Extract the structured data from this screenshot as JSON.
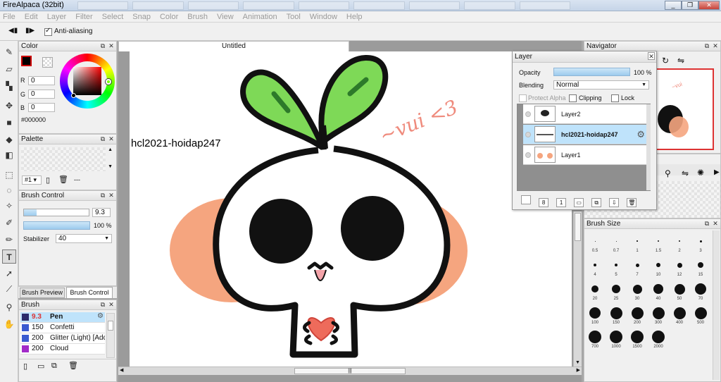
{
  "window": {
    "title": "FireAlpaca (32bit)",
    "min": "_",
    "max": "❐",
    "close": "✕"
  },
  "menu": [
    "File",
    "Edit",
    "Layer",
    "Filter",
    "Select",
    "Snap",
    "Color",
    "Brush",
    "View",
    "Animation",
    "Tool",
    "Window",
    "Help"
  ],
  "options": {
    "anti_alias_label": "Anti-aliasing",
    "anti_alias_checked": true
  },
  "color_panel": {
    "title": "Color",
    "r_label": "R",
    "r": "0",
    "g_label": "G",
    "g": "0",
    "b_label": "B",
    "b": "0",
    "hex": "#000000",
    "fg": "#000000"
  },
  "palette_panel": {
    "title": "Palette",
    "set": "#1",
    "ellipsis": "---"
  },
  "brush_control": {
    "title": "Brush Control",
    "size": "9.3",
    "opacity": "100 %",
    "stabilizer_label": "Stabilizer",
    "stabilizer": "40"
  },
  "bottom_tabs": [
    "Brush Preview",
    "Brush Control"
  ],
  "brush_panel": {
    "title": "Brush",
    "items": [
      {
        "size": "9.3",
        "name": "Pen",
        "color": "#2b2b6b"
      },
      {
        "size": "150",
        "name": "Confetti",
        "color": "#3a5bd0"
      },
      {
        "size": "200",
        "name": "Glitter (Light) [Add]",
        "color": "#3a5bd0"
      },
      {
        "size": "200",
        "name": "Cloud",
        "color": "#a22bc8"
      }
    ]
  },
  "document": {
    "tab": "Untitled",
    "watermark": "hcl2021-hoidap247",
    "signature": "~vui <3"
  },
  "layer_panel": {
    "title": "Layer",
    "opacity_label": "Opacity",
    "opacity": "100 %",
    "blending_label": "Blending",
    "blending": "Normal",
    "protect_alpha": "Protect Alpha",
    "clipping": "Clipping",
    "lock": "Lock",
    "layers": [
      {
        "name": "Layer2"
      },
      {
        "name": "hcl2021-hoidap247"
      },
      {
        "name": "Layer1"
      }
    ]
  },
  "navigator": {
    "title": "Navigator"
  },
  "brush_size": {
    "title": "Brush Size",
    "sizes": [
      "0.5",
      "0.7",
      "1",
      "1.5",
      "2",
      "3",
      "4",
      "5",
      "7",
      "10",
      "12",
      "15",
      "20",
      "25",
      "30",
      "40",
      "50",
      "70",
      "100",
      "150",
      "200",
      "300",
      "400",
      "500",
      "700",
      "1000",
      "1500",
      "2000"
    ]
  },
  "icons": {
    "menu_hint": "⋮"
  }
}
